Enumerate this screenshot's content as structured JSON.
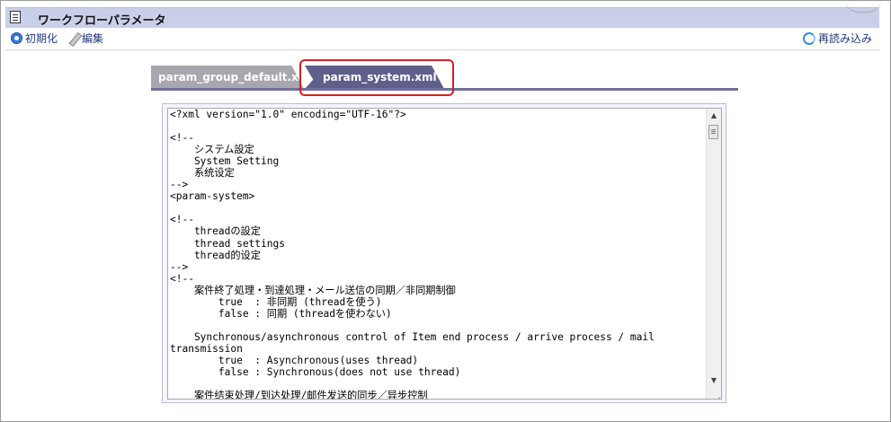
{
  "window": {
    "title": "ワークフローパラメータ"
  },
  "toolbar": {
    "init_label": "初期化",
    "edit_label": "編集",
    "reload_label": "再読み込み"
  },
  "tabs": [
    {
      "label": "param_group_default.xml",
      "active": false
    },
    {
      "label": "param_system.xml",
      "active": true
    }
  ],
  "editor": {
    "content": "<?xml version=\"1.0\" encoding=\"UTF-16\"?>\n\n<!--\n    システム設定\n    System Setting\n    系统设定\n-->\n<param-system>\n\n<!--\n    threadの設定\n    thread settings\n    thread的设定\n-->\n<!--\n    案件終了処理・到達処理・メール送信の同期／非同期制御\n        true  : 非同期 (threadを使う)\n        false : 同期 (threadを使わない)\n\n    Synchronous/asynchronous control of Item end process / arrive process / mail\ntransmission\n        true  : Asynchronous(uses thread)\n        false : Synchronous(does not use thread)\n\n    案件结束处理/到达处理/邮件发送的同步／异步控制"
  },
  "colors": {
    "titlebar_bg": "#c9cfe8",
    "tab_active": "#5f5f8c",
    "tab_inactive": "#a7a7ad",
    "highlight": "#d42020"
  }
}
